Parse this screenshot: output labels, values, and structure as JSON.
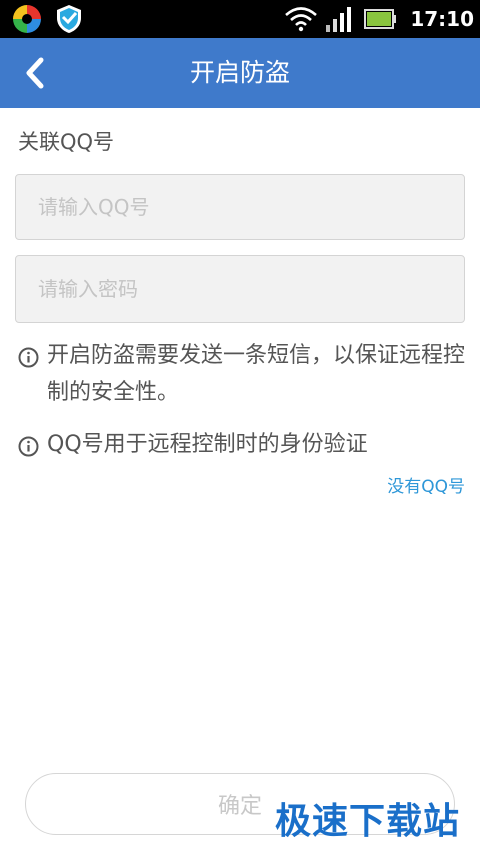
{
  "status_bar": {
    "time": "17:10",
    "icons": [
      "colorful-app-icon",
      "shield-app-icon",
      "wifi-icon",
      "signal-icon",
      "battery-icon"
    ],
    "battery_color": "#8ac53f"
  },
  "header": {
    "title": "开启防盗",
    "back_icon": "chevron-left-icon",
    "color": "#3f7acb"
  },
  "form": {
    "section_label": "关联QQ号",
    "qq_placeholder": "请输入QQ号",
    "password_placeholder": "请输入密码"
  },
  "info": {
    "line1": "开启防盗需要发送一条短信，以保证远程控制的安全性。",
    "line2": "QQ号用于远程控制时的身份验证"
  },
  "links": {
    "no_qq": "没有QQ号"
  },
  "buttons": {
    "confirm": "确定"
  },
  "watermark": "极速下载站"
}
